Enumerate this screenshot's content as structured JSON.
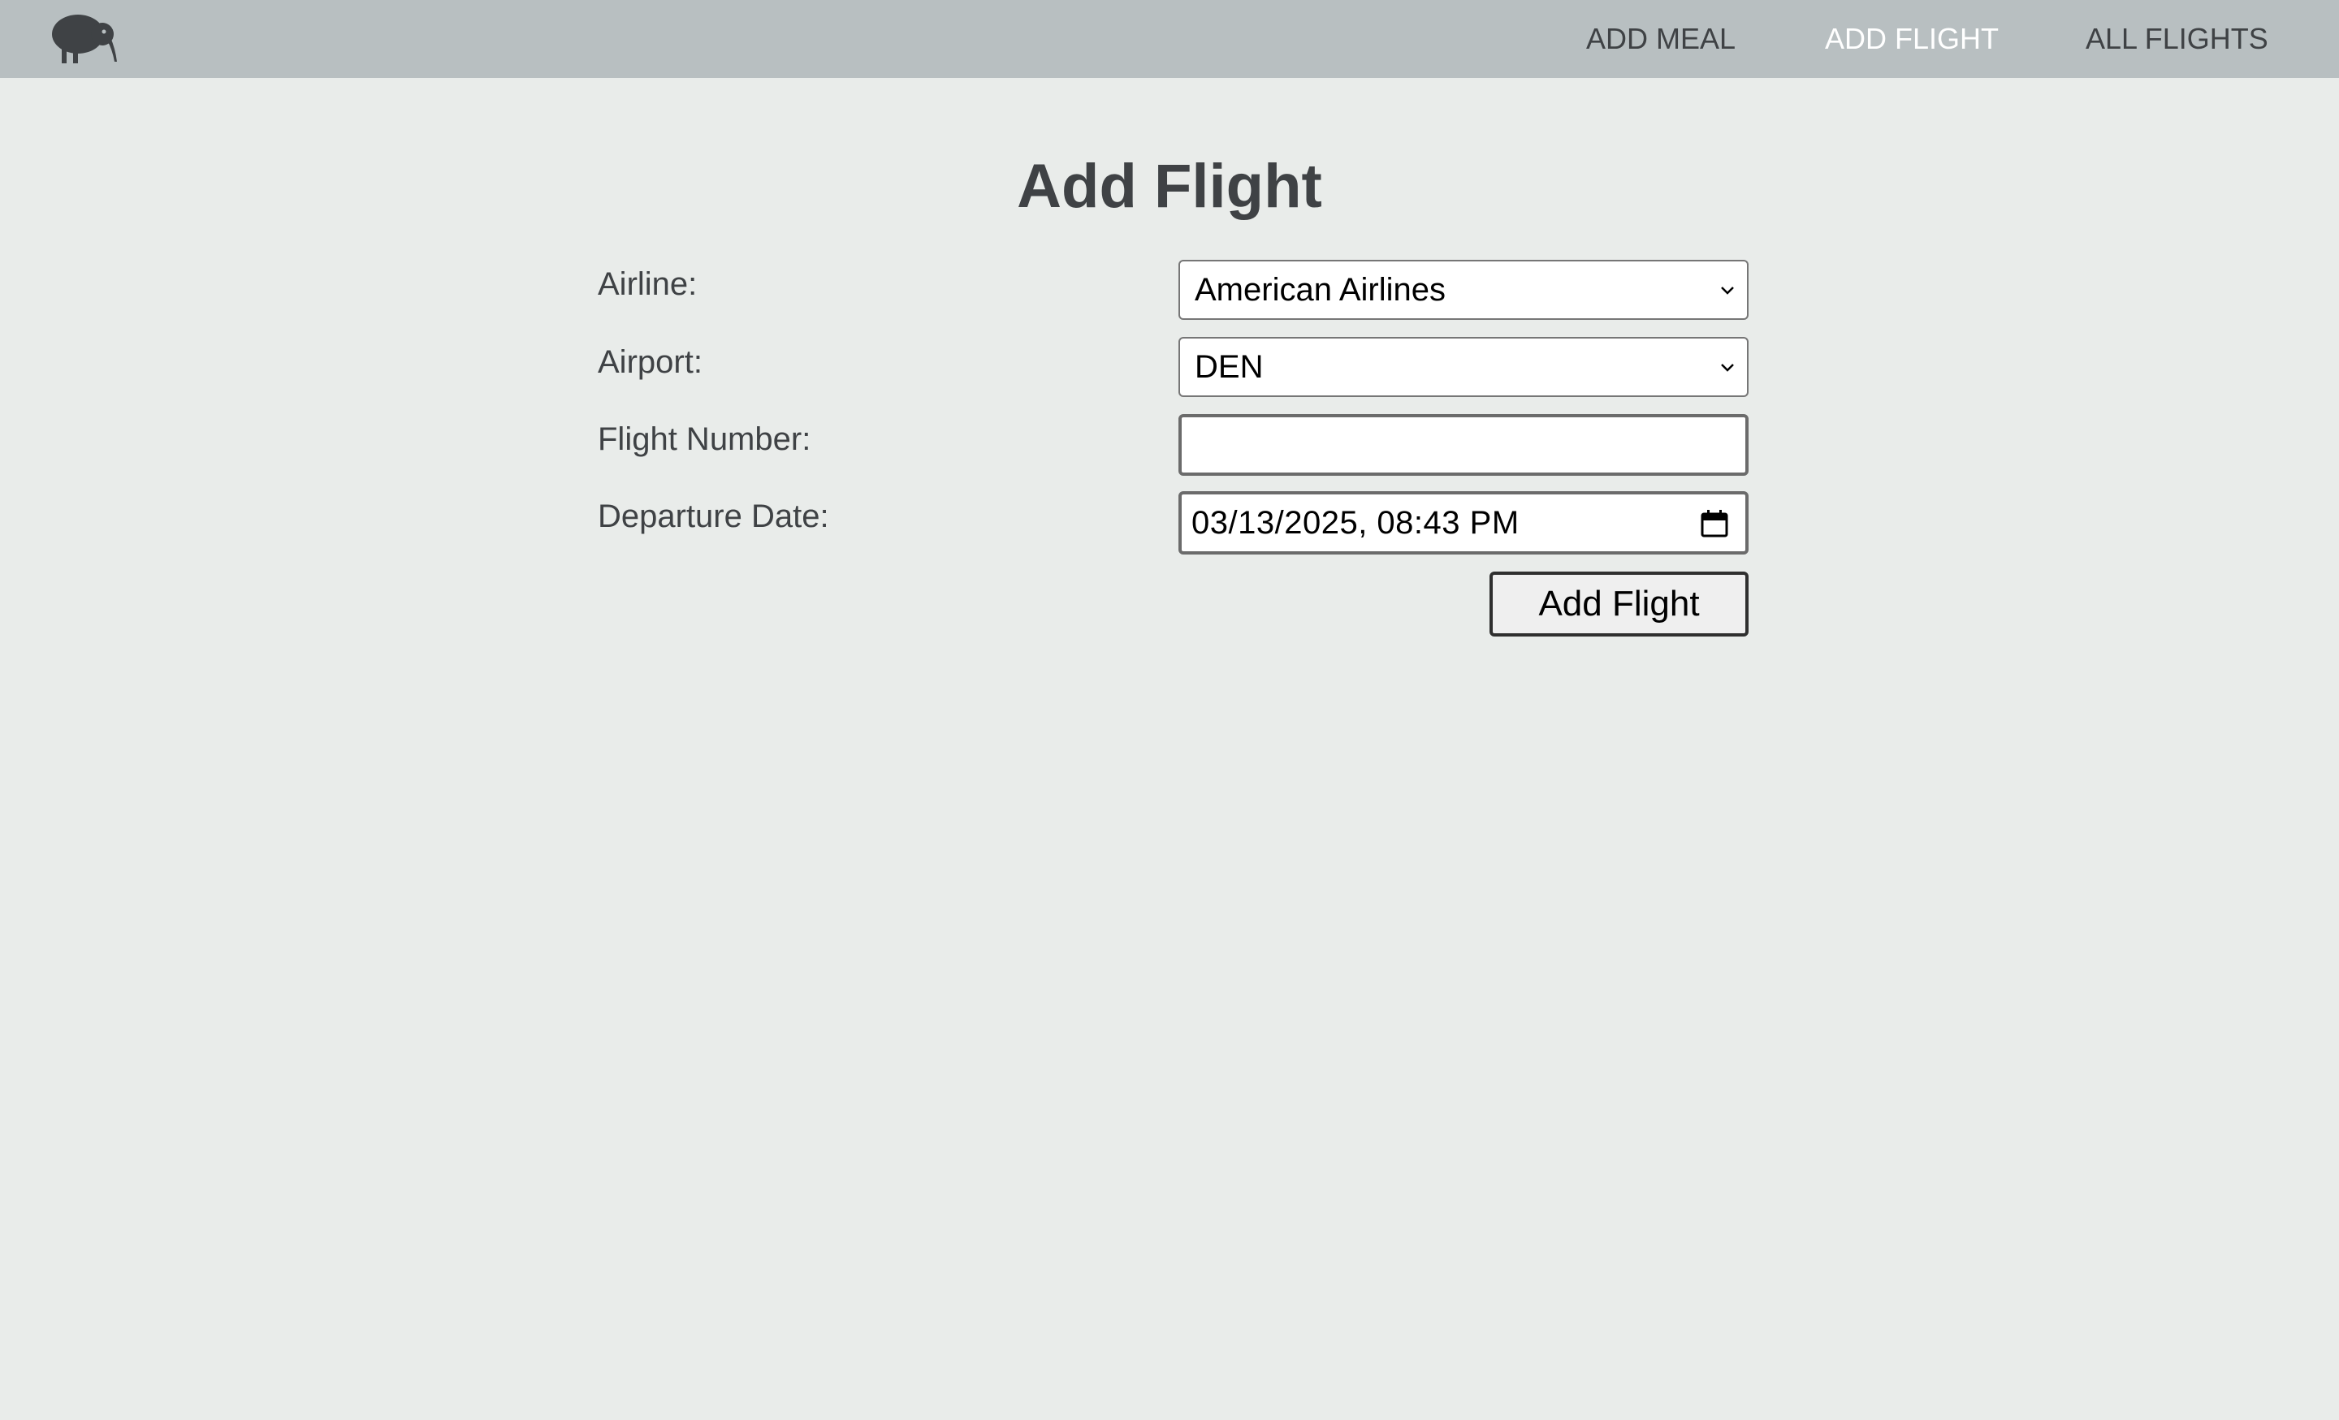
{
  "nav": {
    "logo_icon": "kiwi-bird-icon",
    "items": [
      {
        "label": "ADD MEAL",
        "active": false
      },
      {
        "label": "ADD FLIGHT",
        "active": true
      },
      {
        "label": "ALL FLIGHTS",
        "active": false
      }
    ]
  },
  "page": {
    "title": "Add Flight"
  },
  "form": {
    "airline": {
      "label": "Airline:",
      "value": "American Airlines"
    },
    "airport": {
      "label": "Airport:",
      "value": "DEN"
    },
    "flight_number": {
      "label": "Flight Number:",
      "value": "",
      "placeholder": ""
    },
    "departure_date": {
      "label": "Departure Date:",
      "value": "03/13/2025, 08:43 PM",
      "icon": "calendar-icon"
    },
    "submit_label": "Add Flight"
  },
  "colors": {
    "topbar": "#b8bfc1",
    "background": "#e9ecea",
    "text": "#3f4245",
    "active_nav": "#ffffff"
  }
}
